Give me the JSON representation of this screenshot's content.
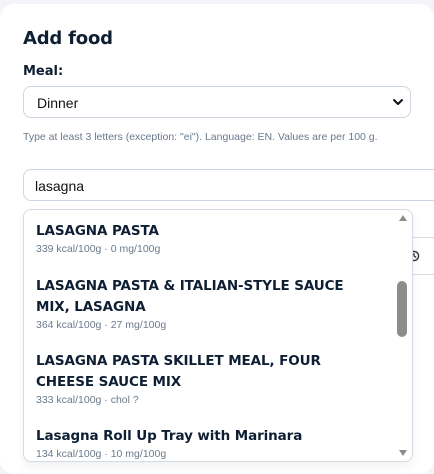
{
  "panel": {
    "title": "Add food",
    "meal_label": "Meal:",
    "meal_selected": "Dinner",
    "hint": "Type at least 3 letters (exception: \"ei\"). Language: EN. Values are per 100 g.",
    "search_value": "lasagna"
  },
  "suggestions": [
    {
      "name": "LASAGNA PASTA",
      "meta": "339 kcal/100g · 0 mg/100g"
    },
    {
      "name": "LASAGNA PASTA & ITALIAN-STYLE SAUCE MIX, LASAGNA",
      "meta": "364 kcal/100g · 27 mg/100g"
    },
    {
      "name": "LASAGNA PASTA SKILLET MEAL, FOUR CHEESE SAUCE MIX",
      "meta": "333 kcal/100g · chol ?"
    },
    {
      "name": "Lasagna Roll Up Tray with Marinara",
      "meta": "134 kcal/100g · 10 mg/100g"
    }
  ],
  "icons": {
    "select": "chevron-down-icon",
    "hidden_button": "clock-icon",
    "scroll_up": "triangle-up-icon",
    "scroll_down": "triangle-down-icon"
  },
  "colors": {
    "text_dark": "#0f1f33",
    "text_muted": "#6b7a8c",
    "border": "#ccd6e0",
    "scroll_thumb": "#8c8c8c"
  }
}
